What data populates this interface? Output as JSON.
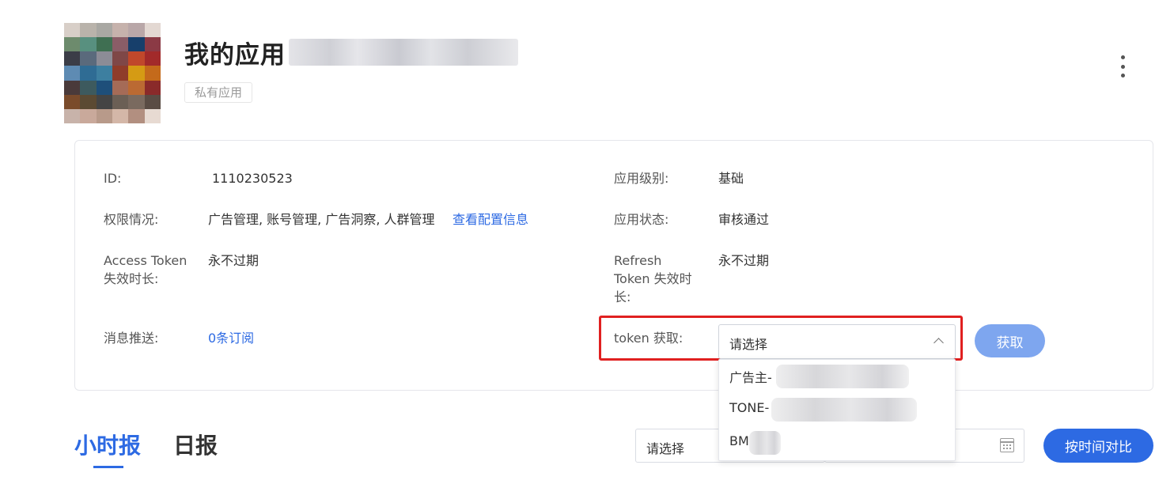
{
  "header": {
    "app_title": "我的应用",
    "app_type_tag": "私有应用",
    "avatar_colors": [
      "#d8cfc8",
      "#b9b3ab",
      "#a9a8a3",
      "#c6b2ac",
      "#b9a7a8",
      "#e3d8d2",
      "#6d8b6d",
      "#58907f",
      "#3f6f52",
      "#8a5d67",
      "#173f6b",
      "#8b3a45",
      "#3b3d47",
      "#5a6a7c",
      "#8c8c96",
      "#7f4747",
      "#c0482b",
      "#a22a2a",
      "#5e8bb3",
      "#2f6c94",
      "#3d7fa0",
      "#8f3c2a",
      "#d59b14",
      "#c46a1b",
      "#4a3a3a",
      "#3d5a5e",
      "#1e4f7a",
      "#a56b57",
      "#bb6a33",
      "#8a2a2a",
      "#7a4b2b",
      "#5b4a33",
      "#444444",
      "#6b5f55",
      "#7a6a5f",
      "#5a4c44",
      "#c8b3aa",
      "#c9a99b",
      "#b89a8a",
      "#d4b7a8",
      "#b28f80",
      "#e7dad2"
    ]
  },
  "info": {
    "id_label": "ID:",
    "id_value": "1110230523",
    "permission_label": "权限情况:",
    "permission_value": "广告管理, 账号管理, 广告洞察, 人群管理",
    "permission_link": "查看配置信息",
    "access_token_label_1": "Access Token",
    "access_token_label_2": "失效时长:",
    "access_token_value": "永不过期",
    "message_push_label": "消息推送:",
    "message_push_link": "0条订阅",
    "app_level_label": "应用级别:",
    "app_level_value": "基础",
    "app_status_label": "应用状态:",
    "app_status_value": "审核通过",
    "refresh_token_label_1": "Refresh",
    "refresh_token_label_2": "Token 失效时",
    "refresh_token_label_3": "长:",
    "refresh_token_value": "永不过期",
    "token_label": "token 获取:",
    "token_select_placeholder": "请选择",
    "token_get_button": "获取",
    "token_options": [
      "广告主-",
      "TONE-",
      "BM-"
    ]
  },
  "report": {
    "tab_hourly": "小时报",
    "tab_daily": "日报",
    "select_placeholder": "请选择",
    "compare_button": "按时间对比"
  },
  "colors": {
    "accent": "#2d6ae3",
    "highlight": "#e02020",
    "button_disabled": "#7ea6ef"
  }
}
